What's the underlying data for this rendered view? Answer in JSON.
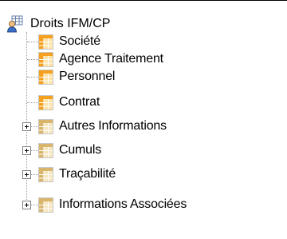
{
  "tree": {
    "root": {
      "label": "Droits IFM/CP",
      "icon": "user-security-icon"
    },
    "leaves": [
      {
        "label": "Société",
        "icon": "table-icon"
      },
      {
        "label": "Agence Traitement",
        "icon": "table-icon"
      },
      {
        "label": "Personnel",
        "icon": "table-icon"
      },
      {
        "label": "Contrat",
        "icon": "table-icon"
      }
    ],
    "groups": [
      {
        "label": "Autres Informations",
        "icon": "folder-table-icon",
        "expander": "plus"
      },
      {
        "label": "Cumuls",
        "icon": "folder-table-icon",
        "expander": "plus"
      },
      {
        "label": "Traçabilité",
        "icon": "folder-table-icon",
        "expander": "plus"
      },
      {
        "label": "Informations Associées",
        "icon": "folder-table-icon",
        "expander": "plus"
      }
    ]
  },
  "colors": {
    "table_orange": "#f5a01f",
    "table_light": "#fde3a8",
    "group_tan": "#d9b56b",
    "dotted_line": "#9a9a9a"
  }
}
